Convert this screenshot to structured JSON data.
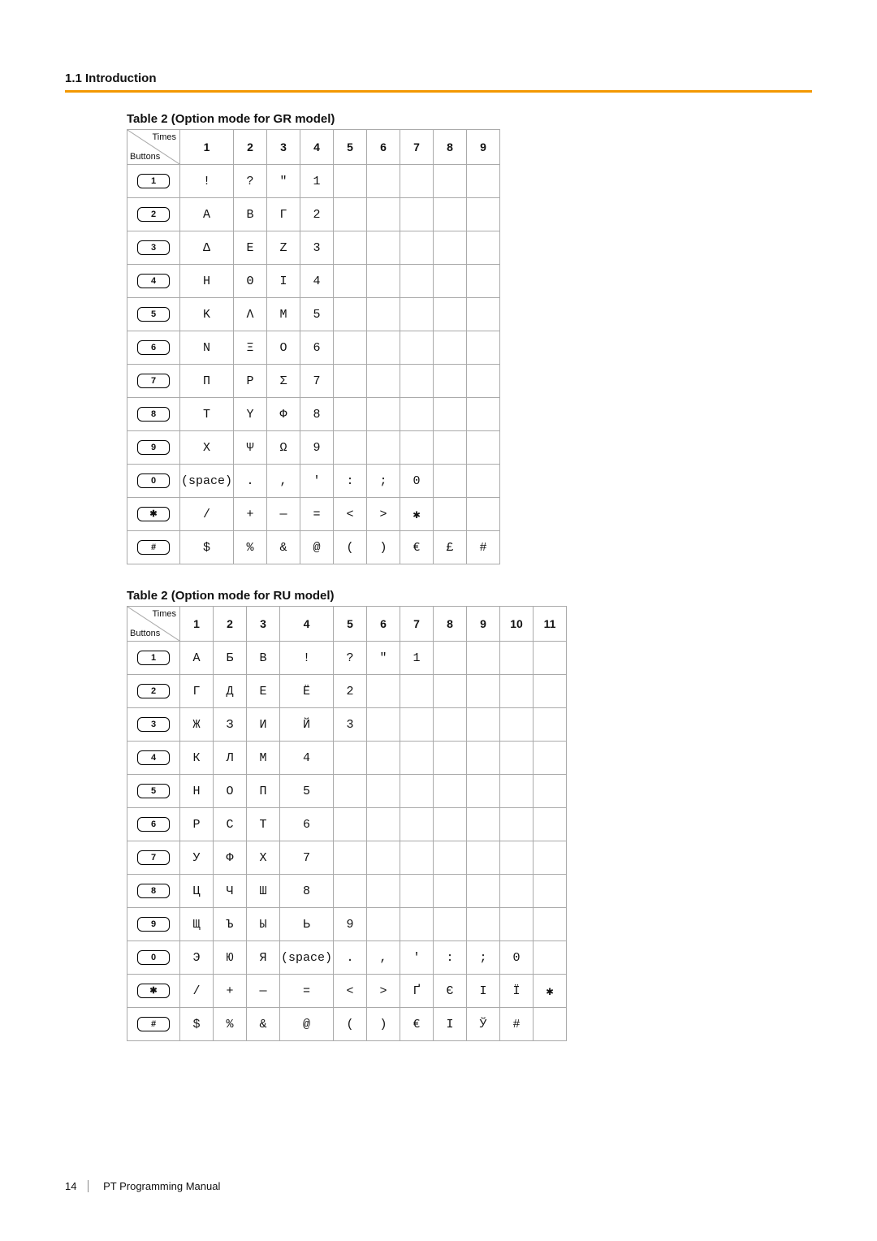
{
  "section_header": "1.1 Introduction",
  "footer": {
    "page": "14",
    "title": "PT Programming Manual"
  },
  "corner": {
    "times": "Times",
    "buttons": "Buttons"
  },
  "tables": [
    {
      "title": "Table 2 (Option mode for GR model)",
      "columns": [
        "1",
        "2",
        "3",
        "4",
        "5",
        "6",
        "7",
        "8",
        "9"
      ],
      "font": "mono",
      "rows": [
        {
          "button": "1",
          "cells": [
            "!",
            "?",
            "\"",
            "1",
            "",
            "",
            "",
            "",
            ""
          ]
        },
        {
          "button": "2",
          "cells": [
            "Α",
            "Β",
            "Γ",
            "2",
            "",
            "",
            "",
            "",
            ""
          ]
        },
        {
          "button": "3",
          "cells": [
            "Δ",
            "Ε",
            "Ζ",
            "3",
            "",
            "",
            "",
            "",
            ""
          ]
        },
        {
          "button": "4",
          "cells": [
            "Η",
            "Θ",
            "Ι",
            "4",
            "",
            "",
            "",
            "",
            ""
          ]
        },
        {
          "button": "5",
          "cells": [
            "Κ",
            "Λ",
            "Μ",
            "5",
            "",
            "",
            "",
            "",
            ""
          ]
        },
        {
          "button": "6",
          "cells": [
            "Ν",
            "Ξ",
            "Ο",
            "6",
            "",
            "",
            "",
            "",
            ""
          ]
        },
        {
          "button": "7",
          "cells": [
            "Π",
            "Ρ",
            "Σ",
            "7",
            "",
            "",
            "",
            "",
            ""
          ]
        },
        {
          "button": "8",
          "cells": [
            "Τ",
            "Υ",
            "Φ",
            "8",
            "",
            "",
            "",
            "",
            ""
          ]
        },
        {
          "button": "9",
          "cells": [
            "Χ",
            "Ψ",
            "Ω",
            "9",
            "",
            "",
            "",
            "",
            ""
          ]
        },
        {
          "button": "0",
          "cells": [
            "(space)",
            ".",
            ",",
            "'",
            ":",
            ";",
            "0",
            "",
            ""
          ],
          "small_indexes": [
            0
          ]
        },
        {
          "button": "✱",
          "cells": [
            "/",
            "+",
            "—",
            "=",
            "<",
            ">",
            "✱",
            "",
            ""
          ]
        },
        {
          "button": "#",
          "cells": [
            "$",
            "%",
            "&",
            "@",
            "(",
            ")",
            "€",
            "£",
            "#"
          ]
        }
      ]
    },
    {
      "title": "Table 2 (Option mode for RU model)",
      "columns": [
        "1",
        "2",
        "3",
        "4",
        "5",
        "6",
        "7",
        "8",
        "9",
        "10",
        "11"
      ],
      "font": "ru",
      "rows": [
        {
          "button": "1",
          "cells": [
            "А",
            "Б",
            "В",
            "!",
            "?",
            "\"",
            "1",
            "",
            "",
            "",
            ""
          ]
        },
        {
          "button": "2",
          "cells": [
            "Г",
            "Д",
            "Е",
            "Ё",
            "2",
            "",
            "",
            "",
            "",
            "",
            ""
          ]
        },
        {
          "button": "3",
          "cells": [
            "Ж",
            "З",
            "И",
            "Й",
            "3",
            "",
            "",
            "",
            "",
            "",
            ""
          ]
        },
        {
          "button": "4",
          "cells": [
            "К",
            "Л",
            "М",
            "4",
            "",
            "",
            "",
            "",
            "",
            "",
            ""
          ]
        },
        {
          "button": "5",
          "cells": [
            "Н",
            "О",
            "П",
            "5",
            "",
            "",
            "",
            "",
            "",
            "",
            ""
          ]
        },
        {
          "button": "6",
          "cells": [
            "Р",
            "С",
            "Т",
            "6",
            "",
            "",
            "",
            "",
            "",
            "",
            ""
          ]
        },
        {
          "button": "7",
          "cells": [
            "У",
            "Ф",
            "Х",
            "7",
            "",
            "",
            "",
            "",
            "",
            "",
            ""
          ]
        },
        {
          "button": "8",
          "cells": [
            "Ц",
            "Ч",
            "Ш",
            "8",
            "",
            "",
            "",
            "",
            "",
            "",
            ""
          ]
        },
        {
          "button": "9",
          "cells": [
            "Щ",
            "Ъ",
            "Ы",
            "Ь",
            "9",
            "",
            "",
            "",
            "",
            "",
            ""
          ]
        },
        {
          "button": "0",
          "cells": [
            "Э",
            "Ю",
            "Я",
            "(space)",
            ".",
            ",",
            "'",
            ":",
            ";",
            "0",
            ""
          ],
          "small_indexes": [
            3
          ]
        },
        {
          "button": "✱",
          "cells": [
            "/",
            "+",
            "—",
            "=",
            "<",
            ">",
            "Ґ",
            "Є",
            "І",
            "Ї",
            "✱"
          ]
        },
        {
          "button": "#",
          "cells": [
            "$",
            "%",
            "&",
            "@",
            "(",
            ")",
            "€",
            "І",
            "Ў",
            "#",
            ""
          ]
        }
      ]
    }
  ]
}
